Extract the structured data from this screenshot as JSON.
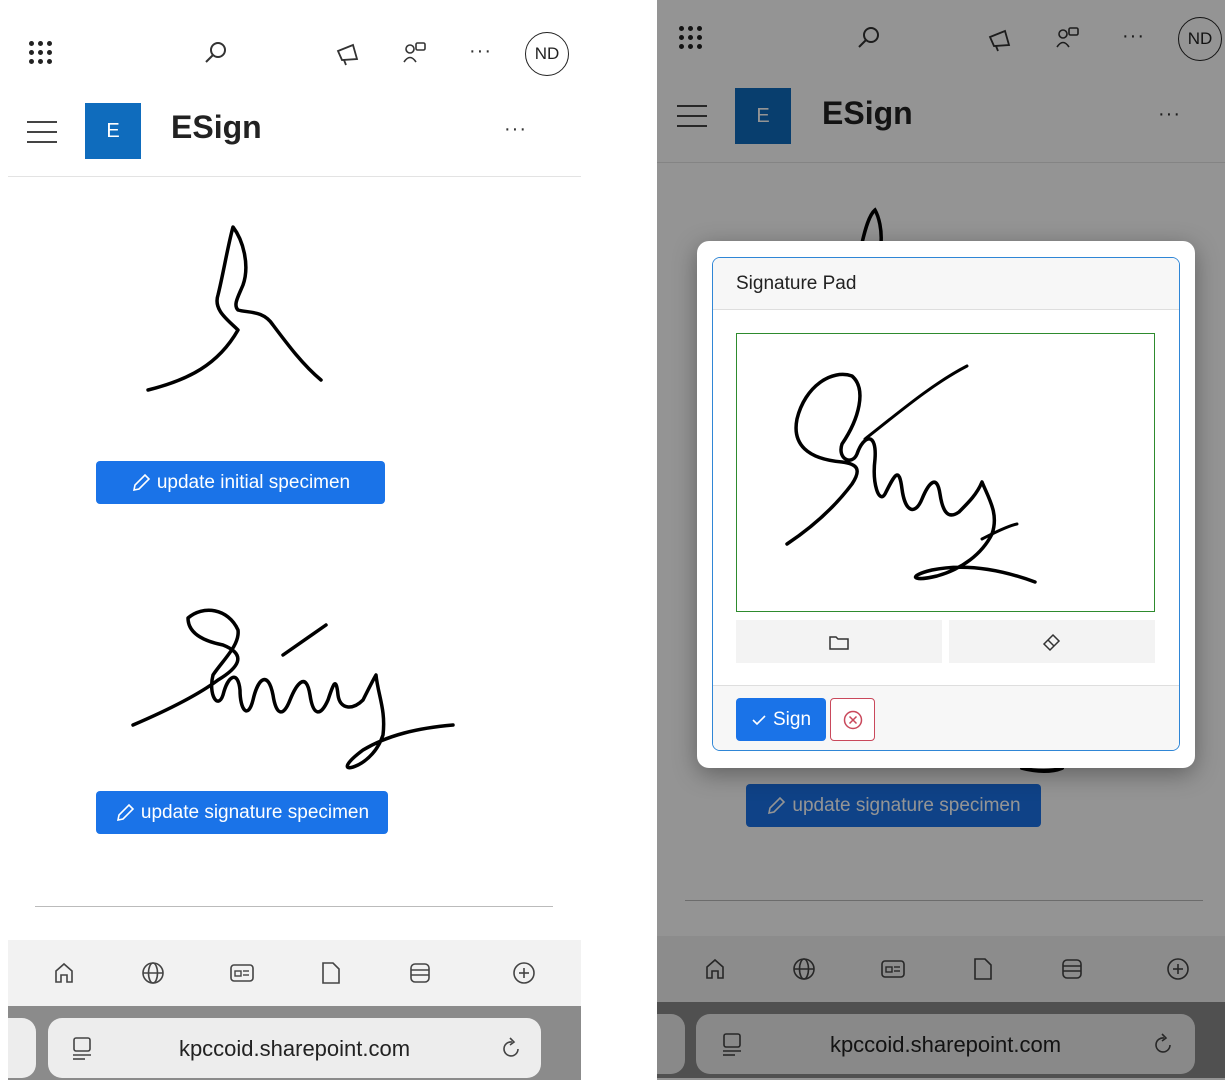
{
  "suitebar": {
    "app_launcher_icon": "waffle-icon",
    "search_icon": "search-icon",
    "announcement_icon": "megaphone-icon",
    "people_icon": "people-icon",
    "more_label": "···",
    "avatar_initials": "ND"
  },
  "site": {
    "logo_letter": "E",
    "title": "ESign",
    "more_label": "···"
  },
  "buttons": {
    "update_initial": "update initial specimen",
    "update_signature": "update signature specimen"
  },
  "tabbar": {
    "items": [
      "home-icon",
      "globe-icon",
      "contact-card-icon",
      "document-icon",
      "list-icon",
      "add-icon"
    ]
  },
  "address": {
    "url": "kpccoid.sharepoint.com",
    "reader_icon": "reader-icon",
    "reload_icon": "reload-icon"
  },
  "signature_pad": {
    "title": "Signature Pad",
    "open_icon": "folder-icon",
    "clear_icon": "eraser-icon",
    "sign_label": "Sign",
    "cancel_icon": "cancel-circle-icon"
  },
  "colors": {
    "brand": "#0f6cbd",
    "primary_button": "#1a73e8",
    "pad_border": "#2e8b2e",
    "cancel_border": "#c9485b"
  }
}
